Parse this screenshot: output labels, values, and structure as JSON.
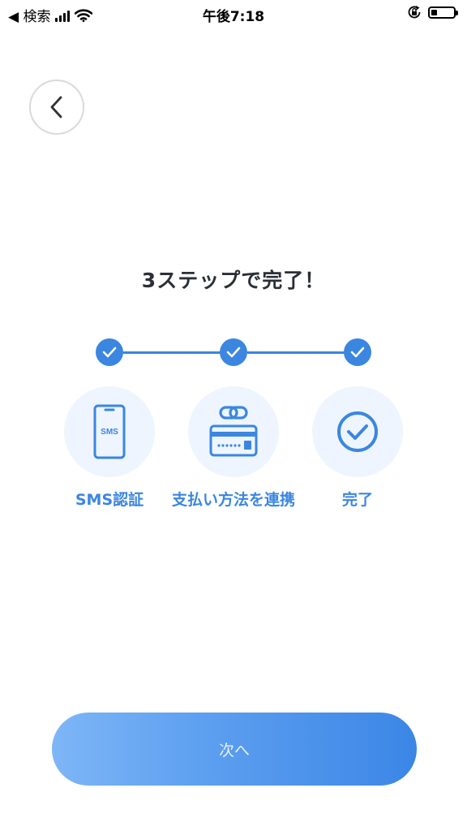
{
  "status_bar": {
    "back_app": "◀ 検索",
    "time": "午後7:18",
    "battery_level": 0.25
  },
  "icons": {
    "back": "chevron-left-icon",
    "step1": "smartphone-sms-icon",
    "step2": "linked-card-icon",
    "step3": "check-circle-icon"
  },
  "title": "3ステップで完了！",
  "steps": [
    {
      "label": "SMS認証",
      "icon_text": "SMS",
      "done": true
    },
    {
      "label": "支払い方法を連携",
      "done": true
    },
    {
      "label": "完了",
      "done": true
    }
  ],
  "next_button": {
    "label": "次へ"
  },
  "colors": {
    "accent": "#3b86e0",
    "step_bg": "#eef5fe",
    "button_from": "#7eb6f7",
    "button_to": "#3b86e6"
  }
}
